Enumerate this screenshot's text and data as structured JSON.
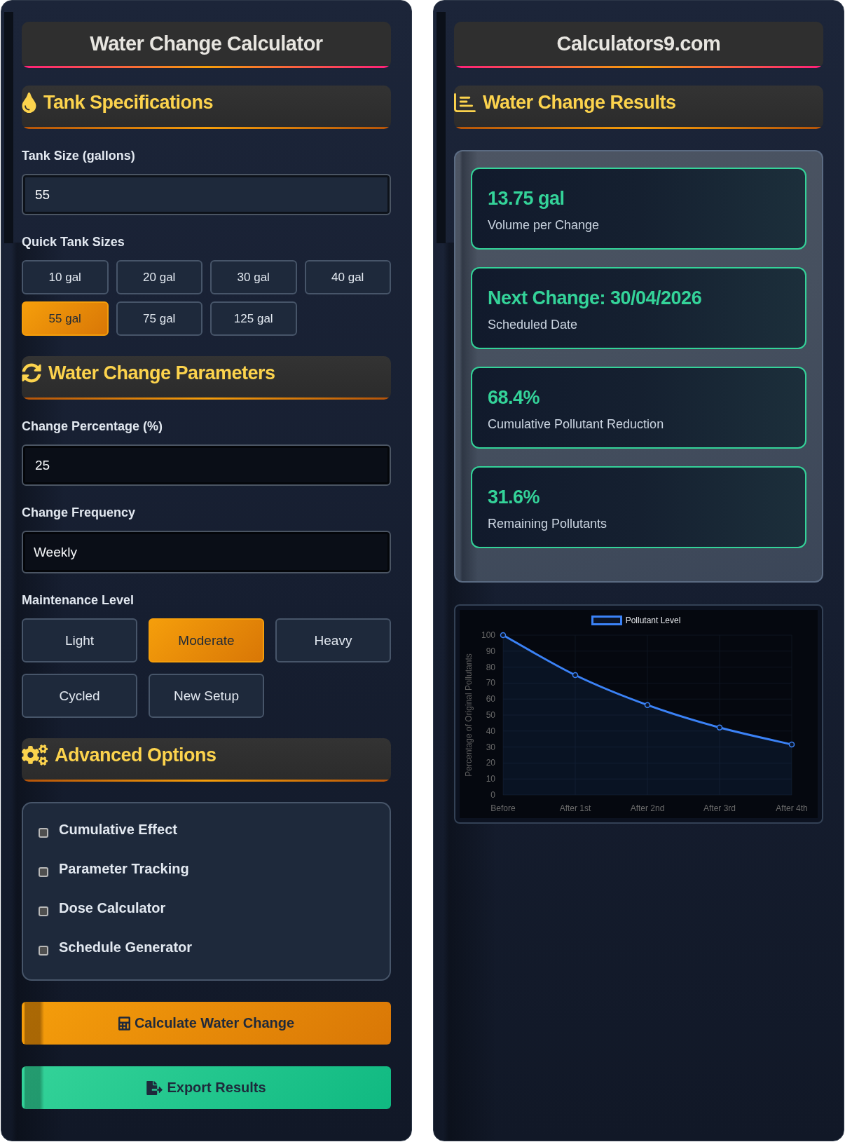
{
  "form_panel": {
    "title": "Water Change Calculator"
  },
  "tank_specifications": {
    "heading": "Tank Specifications",
    "tank_size": {
      "label": "Tank Size (gallons)",
      "value": "55"
    },
    "quick_sizes": {
      "label": "Quick Tank Sizes",
      "options": [
        {
          "label": "10 gal",
          "selected": false
        },
        {
          "label": "20 gal",
          "selected": false
        },
        {
          "label": "30 gal",
          "selected": false
        },
        {
          "label": "40 gal",
          "selected": false
        },
        {
          "label": "55 gal",
          "selected": true
        },
        {
          "label": "75 gal",
          "selected": false
        },
        {
          "label": "125 gal",
          "selected": false
        }
      ]
    }
  },
  "water_change_parameters": {
    "heading": "Water Change Parameters",
    "change_percentage": {
      "label": "Change Percentage (%)",
      "value": "25"
    },
    "change_frequency": {
      "label": "Change Frequency",
      "value": "Weekly"
    },
    "maintenance_level": {
      "label": "Maintenance Level",
      "options": [
        {
          "label": "Light",
          "selected": false
        },
        {
          "label": "Moderate",
          "selected": true
        },
        {
          "label": "Heavy",
          "selected": false
        },
        {
          "label": "Cycled",
          "selected": false
        },
        {
          "label": "New Setup",
          "selected": false
        }
      ]
    }
  },
  "advanced_options": {
    "heading": "Advanced Options",
    "options": [
      {
        "label": "Cumulative Effect",
        "checked": false
      },
      {
        "label": "Parameter Tracking",
        "checked": false
      },
      {
        "label": "Dose Calculator",
        "checked": false
      },
      {
        "label": "Schedule Generator",
        "checked": false
      }
    ]
  },
  "actions": [
    {
      "kind": "calculate",
      "label": "Calculate Water Change"
    },
    {
      "kind": "export",
      "label": "Export Results"
    }
  ],
  "results_panel": {
    "title": "Calculators9.com"
  },
  "results": {
    "heading": "Water Change Results",
    "cards": [
      {
        "value": "13.75 gal",
        "label": "Volume per Change"
      },
      {
        "value": "Next Change: 30/04/2026",
        "label": "Scheduled Date"
      },
      {
        "value": "68.4%",
        "label": "Cumulative Pollutant Reduction"
      },
      {
        "value": "31.6%",
        "label": "Remaining Pollutants"
      }
    ]
  },
  "chart": {
    "chart_data": {
      "type": "area",
      "ylabel": "Percentage of Original Pollutants",
      "categories": [
        "Before",
        "After 1st",
        "After 2nd",
        "After 3rd",
        "After 4th"
      ],
      "series": [
        {
          "name": "Pollutant Level",
          "color": "#3b82f6",
          "marker": "circle",
          "values": [
            100,
            75,
            56.3,
            42.2,
            31.6
          ]
        }
      ],
      "ylim": [
        0,
        100
      ],
      "yticks": [
        0,
        10,
        20,
        30,
        40,
        50,
        60,
        70,
        80,
        90,
        100
      ],
      "grid": true
    }
  }
}
